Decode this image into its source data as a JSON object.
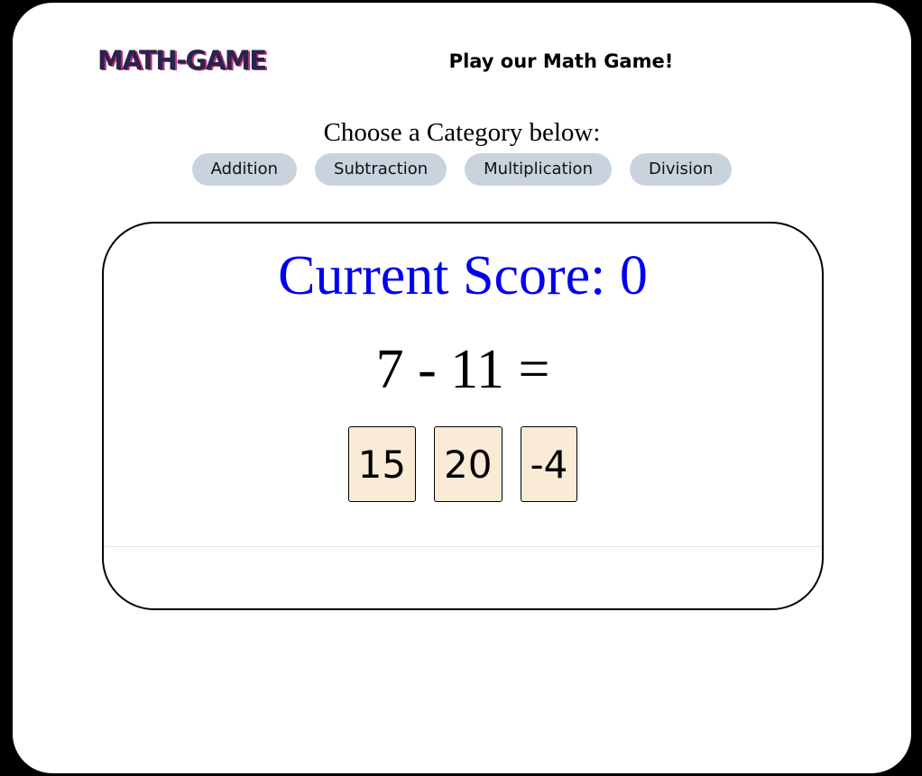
{
  "header": {
    "logo_text": "MATH-GAME",
    "tagline": "Play our Math Game!"
  },
  "categories": {
    "prompt": "Choose a Category below:",
    "items": [
      {
        "label": "Addition"
      },
      {
        "label": "Subtraction"
      },
      {
        "label": "Multiplication"
      },
      {
        "label": "Division"
      }
    ]
  },
  "game": {
    "score_text": "Current Score: 0",
    "question": "7 - 11 =",
    "answers": [
      {
        "label": "15"
      },
      {
        "label": "20"
      },
      {
        "label": "-4"
      }
    ]
  },
  "colors": {
    "score": "#0000ee",
    "category_button": "#c9d3de",
    "answer_button": "#faebd7",
    "logo": "#2a2250",
    "logo_shadow": "#c4306a"
  }
}
